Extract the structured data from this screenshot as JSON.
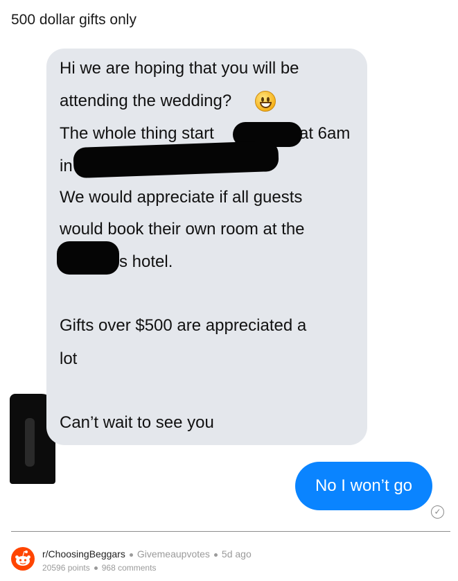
{
  "post": {
    "title": "500 dollar gifts only"
  },
  "chat": {
    "incoming_lines": [
      "Hi we are hoping that you will be",
      "attending the wedding?",
      "The whole thing start",
      "at 6am",
      "in",
      "We would appreciate if all guests",
      "would book their own room at the",
      "s hotel.",
      "Gifts over $500 are appreciated a",
      "lot",
      "Can’t wait to see you"
    ],
    "emoji": "grinning-face",
    "outgoing": "No I won’t go"
  },
  "footer": {
    "subreddit": "r/ChoosingBeggars",
    "user": "Givemeaupvotes",
    "age": "5d ago",
    "points": "20596 points",
    "comments": "968 comments"
  },
  "colors": {
    "outgoing_bubble": "#0a84ff",
    "incoming_bubble": "#e4e7ec",
    "reddit": "#ff4500"
  }
}
